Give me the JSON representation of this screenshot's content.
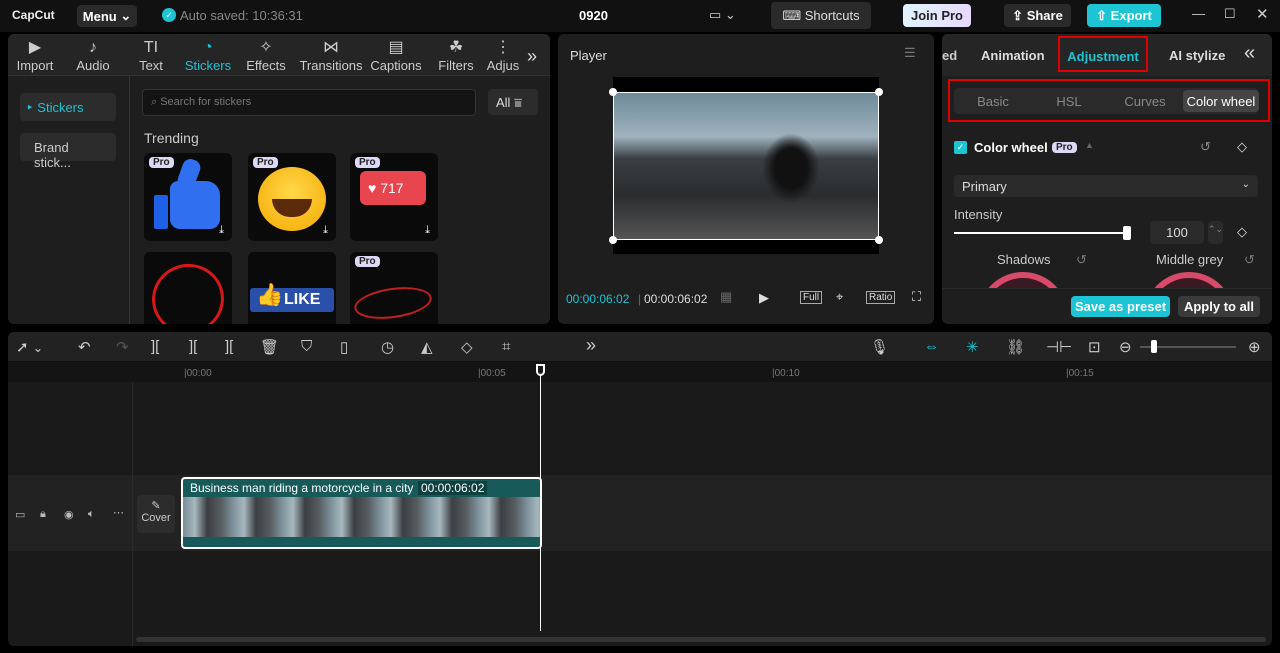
{
  "topbar": {
    "logo": "CapCut",
    "menu": "Menu",
    "autosave": "Auto saved: 10:36:31",
    "project": "0920",
    "shortcuts": "Shortcuts",
    "join_pro": "Join Pro",
    "share": "Share",
    "export": "Export"
  },
  "media_tabs": [
    {
      "label": "Import",
      "icon": "▶"
    },
    {
      "label": "Audio",
      "icon": "♪"
    },
    {
      "label": "Text",
      "icon": "TI"
    },
    {
      "label": "Stickers",
      "icon": "◔"
    },
    {
      "label": "Effects",
      "icon": "✧"
    },
    {
      "label": "Transitions",
      "icon": "⋈"
    },
    {
      "label": "Captions",
      "icon": "▤"
    },
    {
      "label": "Filters",
      "icon": "☘"
    },
    {
      "label": "Adjus",
      "icon": "⋮"
    }
  ],
  "stickers": {
    "sidebar": [
      "Stickers",
      "Brand stick..."
    ],
    "search_placeholder": "Search for stickers",
    "filter": "All",
    "section": "Trending",
    "pro_badge": "Pro",
    "like_count": "717",
    "like_text": "LIKE"
  },
  "player": {
    "title": "Player",
    "current": "00:00:06:02",
    "total": "00:00:06:02",
    "full": "Full",
    "ratio": "Ratio"
  },
  "right": {
    "tabs": [
      "ed",
      "Animation",
      "Adjustment",
      "AI stylize"
    ],
    "subtabs": [
      "Basic",
      "HSL",
      "Curves",
      "Color wheel"
    ],
    "section": "Color wheel",
    "pro": "Pro",
    "mode": "Primary",
    "intensity_label": "Intensity",
    "intensity": 100,
    "wheels": [
      "Shadows",
      "Middle grey"
    ],
    "save_preset": "Save as preset",
    "apply_all": "Apply to all"
  },
  "timeline": {
    "ticks": [
      "00:00",
      "00:05",
      "00:10",
      "00:15"
    ],
    "clip_title": "Business man riding a motorcycle in a city",
    "clip_duration": "00:00:06:02",
    "cover": "Cover"
  },
  "colors": {
    "accent": "#1cc4d4",
    "highlight": "#e00000"
  }
}
